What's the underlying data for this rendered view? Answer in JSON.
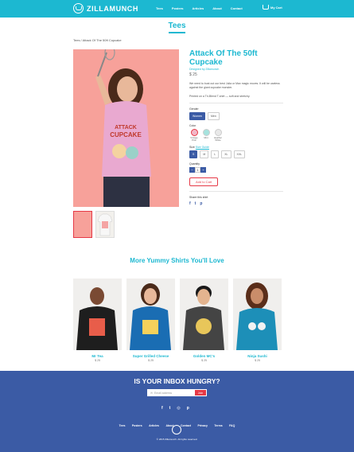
{
  "header": {
    "logo": "ZILLAMUNCH",
    "nav": [
      "Tees",
      "Posters",
      "Articles",
      "About",
      "Contact"
    ],
    "cart": "My Cart"
  },
  "page": {
    "title": "Tees",
    "breadcrumb": "Tees / Attack Of The 50ft Cupcake"
  },
  "product": {
    "title": "Attack Of The 50ft Cupcake",
    "designer": "Designed by Zillamunch",
    "price": "$ 25",
    "description": "We need to bust out our best Julia or Max magic moves. It will be useless against the giant cupcake monster.",
    "print_note": "Printed on a Tri-Blend T-shirt — soft and stretchy.",
    "gender_label": "Gender",
    "genders": [
      "Women",
      "Men"
    ],
    "color_label": "Color",
    "colors": [
      {
        "name": "Vintage Pink",
        "hex": "#f3b7c7"
      },
      {
        "name": "Mint",
        "hex": "#a6e3de"
      },
      {
        "name": "Heather White",
        "hex": "#e9e9e9"
      }
    ],
    "size_label": "Size",
    "size_chart": "Size Guide",
    "sizes": [
      "S",
      "M",
      "L",
      "XL",
      "XXL"
    ],
    "quantity_label": "Quantity",
    "quantity": "1",
    "add_to_cart": "Add to Cart",
    "share_label": "Share this shirt",
    "share_icons": [
      "facebook-icon",
      "twitter-icon",
      "pinterest-icon"
    ]
  },
  "related": {
    "title": "More Yummy Shirts You'll Love",
    "items": [
      {
        "name": "Mr Tea",
        "price": "$ 25",
        "shirt_color": "#1e1e1e"
      },
      {
        "name": "Super Grilled Cheese",
        "price": "$ 25",
        "shirt_color": "#1a6db3"
      },
      {
        "name": "Golden MC's",
        "price": "$ 25",
        "shirt_color": "#444444"
      },
      {
        "name": "Ninja Sushi",
        "price": "$ 25",
        "shirt_color": "#1d8fb8"
      }
    ]
  },
  "footer": {
    "title": "IS YOUR INBOX HUNGRY?",
    "email_placeholder": "Email address",
    "subscribe": "Join",
    "social": [
      "facebook-icon",
      "twitter-icon",
      "instagram-icon",
      "pinterest-icon"
    ],
    "links": [
      "Tees",
      "Posters",
      "Articles",
      "About",
      "Contact",
      "Privacy",
      "Terms",
      "FAQ"
    ],
    "copyright": "© 2015 Zillamunch. All rights reserved."
  },
  "colors": {
    "accent": "#1cb8d1",
    "footer": "#3b5ba5",
    "cta": "#e63946"
  }
}
